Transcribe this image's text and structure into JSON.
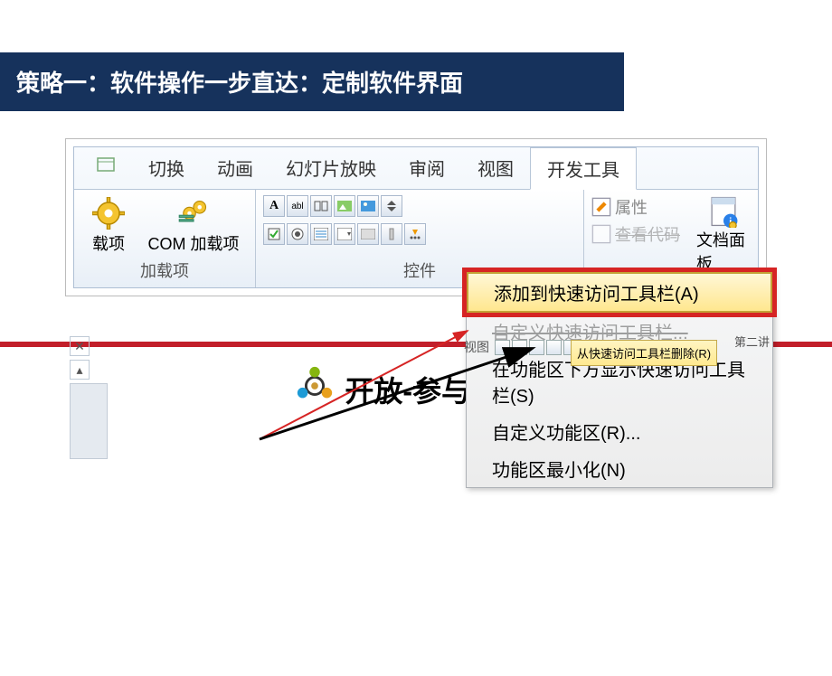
{
  "title": "策略一：软件操作一步直达：定制软件界面",
  "tabs": {
    "editor": "",
    "transition": "切换",
    "animation": "动画",
    "slideshow": "幻灯片放映",
    "review": "审阅",
    "view": "视图",
    "developer": "开发工具"
  },
  "groups": {
    "addins_btn": "载项",
    "com_addins": "COM 加载项",
    "addins_label": "加载项",
    "controls_label": "控件",
    "properties": "属性",
    "docpanel": "文档面板"
  },
  "ctx": {
    "view_code": "查看代码",
    "add_qat": "添加到快速访问工具栏(A)",
    "remove_qat_short": "从快速访问工具栏删除(R)",
    "show_below": "在功能区下方显示快速访问工具栏(S)",
    "customize": "自定义功能区(R)...",
    "minimize": "功能区最小化(N)"
  },
  "mini": {
    "view": "视图",
    "badge": "第二讲"
  },
  "footer": "开放-参与-共享"
}
